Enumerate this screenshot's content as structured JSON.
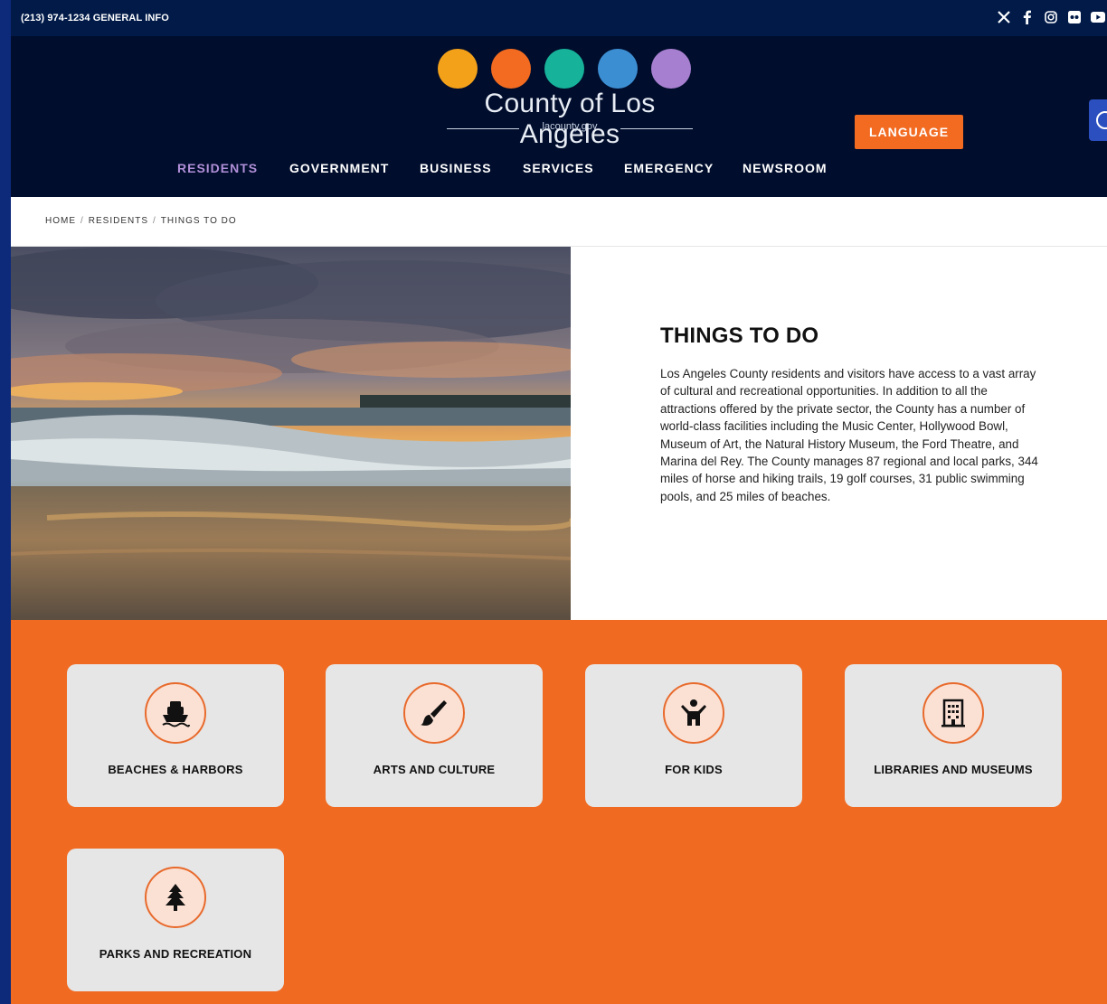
{
  "topbar": {
    "phone": "(213) 974-1234 GENERAL INFO",
    "social": [
      "x-icon",
      "facebook-icon",
      "instagram-icon",
      "flickr-icon",
      "youtube-icon"
    ]
  },
  "logo": {
    "name": "County of Los Angeles",
    "url": "lacounty.gov",
    "circle_colors": [
      "#f4a11a",
      "#f26b21",
      "#16b39a",
      "#3c8ed3",
      "#a77fd0"
    ]
  },
  "nav": {
    "items": [
      {
        "label": "RESIDENTS",
        "active": true
      },
      {
        "label": "GOVERNMENT"
      },
      {
        "label": "BUSINESS"
      },
      {
        "label": "SERVICES"
      },
      {
        "label": "EMERGENCY"
      },
      {
        "label": "NEWSROOM"
      }
    ],
    "language": "LANGUAGE"
  },
  "breadcrumb": [
    "HOME",
    "RESIDENTS",
    "THINGS TO DO"
  ],
  "hero": {
    "title": "THINGS TO DO",
    "body": "Los Angeles County residents and visitors have access to a vast array of cultural and recreational opportunities. In addition to all the attractions offered by the private sector, the County has a number of world-class facilities including the Music Center, Hollywood Bowl, Museum of Art, the Natural History Museum, the Ford Theatre, and Marina del Rey. The County manages 87 regional and local parks, 344 miles of horse and hiking trails, 19 golf courses, 31 public swimming pools, and 25 miles of beaches."
  },
  "cards": [
    {
      "label": "BEACHES & HARBORS",
      "icon": "ship-icon"
    },
    {
      "label": "ARTS AND CULTURE",
      "icon": "paintbrush-icon"
    },
    {
      "label": "FOR KIDS",
      "icon": "child-icon"
    },
    {
      "label": "LIBRARIES AND MUSEUMS",
      "icon": "building-icon"
    },
    {
      "label": "PARKS AND RECREATION",
      "icon": "tree-icon"
    }
  ],
  "colors": {
    "navy": "#000d2c",
    "topbar": "#011a48",
    "accent": "#f26b21",
    "active_nav": "#b18fd8",
    "card_bg": "#e6e6e6"
  }
}
